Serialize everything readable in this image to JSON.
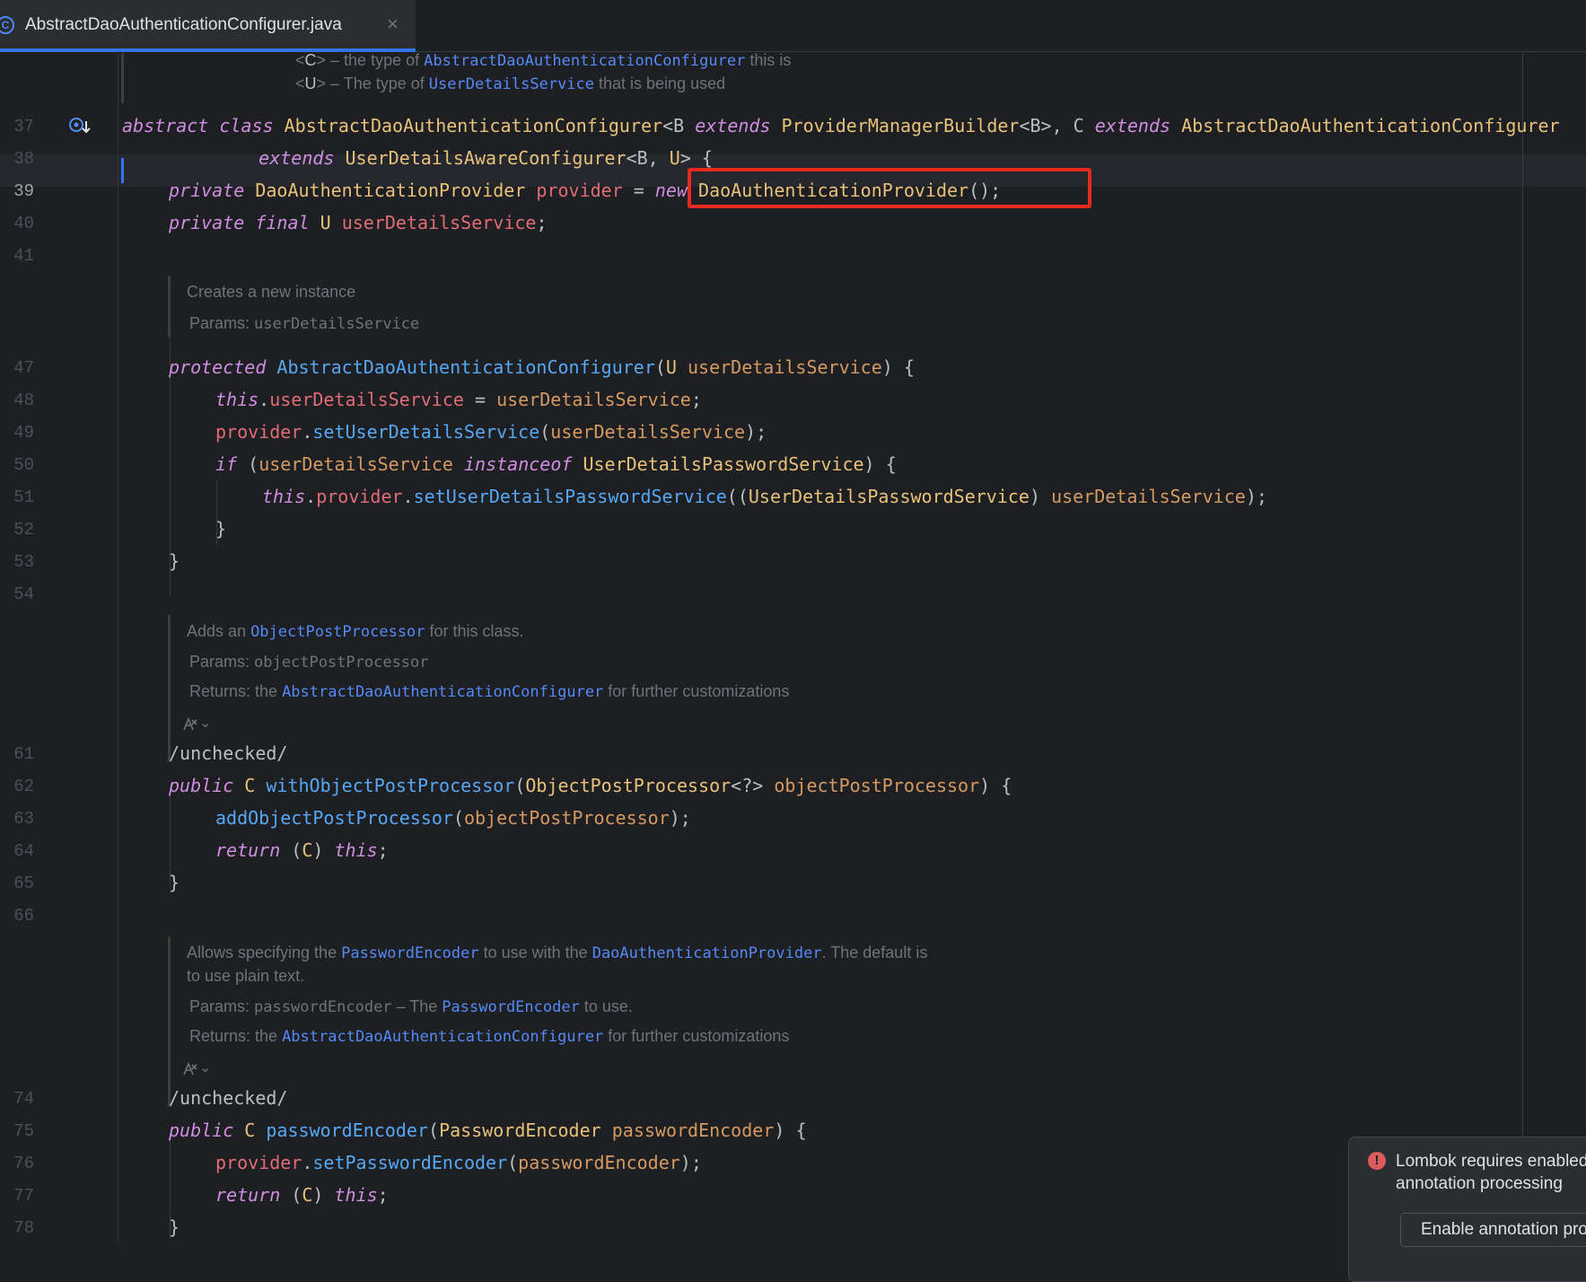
{
  "tab": {
    "icon": "C",
    "title": "AbstractDaoAuthenticationConfigurer.java",
    "close": "×"
  },
  "top_doc": {
    "line1_tag": "C",
    "line1_pre": " – the type of ",
    "line1_link": "AbstractDaoAuthenticationConfigurer",
    "line1_post": " this is",
    "line2_tag": "U",
    "line2_pre": " – The type of ",
    "line2_link": "UserDetailsService",
    "line2_post": " that is being used"
  },
  "line_numbers": {
    "l37": "37",
    "l38": "38",
    "l39": "39",
    "l40": "40",
    "l41": "41",
    "l47": "47",
    "l48": "48",
    "l49": "49",
    "l50": "50",
    "l51": "51",
    "l52": "52",
    "l53": "53",
    "l54": "54",
    "l61": "61",
    "l62": "62",
    "l63": "63",
    "l64": "64",
    "l65": "65",
    "l66": "66",
    "l74": "74",
    "l75": "75",
    "l76": "76",
    "l77": "77",
    "l78": "78"
  },
  "gutter_icon": "implemented-icon",
  "doc1": {
    "text": "Creates a new instance",
    "params_label": "Params:",
    "params_value": "userDetailsService"
  },
  "doc2": {
    "text_pre": "Adds an ",
    "text_link": "ObjectPostProcessor",
    "text_post": " for this class.",
    "params_label": "Params:",
    "params_value": "objectPostProcessor",
    "returns_label": "Returns:",
    "returns_pre": " the ",
    "returns_link": "AbstractDaoAuthenticationConfigurer",
    "returns_post": " for further customizations"
  },
  "doc3": {
    "text_pre": "Allows specifying the ",
    "text_link1": "PasswordEncoder",
    "text_mid": " to use with the ",
    "text_link2": "DaoAuthenticationProvider",
    "text_post": ". The default is",
    "text_line2": "to use plain text.",
    "params_label": "Params:",
    "params_value": "passwordEncoder",
    "params_dash": " – The ",
    "params_link": "PasswordEncoder",
    "params_post": " to use.",
    "returns_label": "Returns:",
    "returns_pre": " the ",
    "returns_link": "AbstractDaoAuthenticationConfigurer",
    "returns_post": " for further customizations"
  },
  "lens_icon": "ai-lens-icon",
  "lens_chevron": "⌄",
  "code": {
    "l37": [
      {
        "t": "abstract",
        "c": "kw"
      },
      {
        "t": " "
      },
      {
        "t": "class",
        "c": "kw"
      },
      {
        "t": " "
      },
      {
        "t": "AbstractDaoAuthenticationConfigurer",
        "c": "ty"
      },
      {
        "t": "<B "
      },
      {
        "t": "extends",
        "c": "kw"
      },
      {
        "t": " "
      },
      {
        "t": "ProviderManagerBuilder",
        "c": "ty"
      },
      {
        "t": "<B>, C "
      },
      {
        "t": "extends",
        "c": "kw"
      },
      {
        "t": " "
      },
      {
        "t": "AbstractDaoAuthenticationConfigurer",
        "c": "ty"
      }
    ],
    "l38": [
      {
        "t": "    "
      },
      {
        "t": "extends",
        "c": "kw"
      },
      {
        "t": " "
      },
      {
        "t": "UserDetailsAwareConfigurer",
        "c": "ty"
      },
      {
        "t": "<B, "
      },
      {
        "t": "U",
        "c": "ty"
      },
      {
        "t": "> {"
      }
    ],
    "l39": [
      {
        "t": "private",
        "c": "kw"
      },
      {
        "t": " "
      },
      {
        "t": "DaoAuthenticationProvider",
        "c": "ty"
      },
      {
        "t": " "
      },
      {
        "t": "provider",
        "c": "fld"
      },
      {
        "t": " = "
      },
      {
        "t": "new",
        "c": "kw"
      },
      {
        "t": " "
      },
      {
        "t": "DaoAuthenticationProvider",
        "c": "ty"
      },
      {
        "t": "();"
      }
    ],
    "l40": [
      {
        "t": "private",
        "c": "kw"
      },
      {
        "t": " "
      },
      {
        "t": "final",
        "c": "kw"
      },
      {
        "t": " "
      },
      {
        "t": "U",
        "c": "ty"
      },
      {
        "t": " "
      },
      {
        "t": "userDetailsService",
        "c": "fld"
      },
      {
        "t": ";"
      }
    ],
    "l47": [
      {
        "t": "protected",
        "c": "kw"
      },
      {
        "t": " "
      },
      {
        "t": "AbstractDaoAuthenticationConfigurer",
        "c": "fn"
      },
      {
        "t": "("
      },
      {
        "t": "U",
        "c": "ty"
      },
      {
        "t": " "
      },
      {
        "t": "userDetailsService",
        "c": "par"
      },
      {
        "t": ") {"
      }
    ],
    "l48": [
      {
        "t": "this",
        "c": "kw"
      },
      {
        "t": "."
      },
      {
        "t": "userDetailsService",
        "c": "fld"
      },
      {
        "t": " = "
      },
      {
        "t": "userDetailsService",
        "c": "par"
      },
      {
        "t": ";"
      }
    ],
    "l49": [
      {
        "t": "provider",
        "c": "fld"
      },
      {
        "t": "."
      },
      {
        "t": "setUserDetailsService",
        "c": "fn"
      },
      {
        "t": "("
      },
      {
        "t": "userDetailsService",
        "c": "par"
      },
      {
        "t": ");"
      }
    ],
    "l50": [
      {
        "t": "if",
        "c": "kw"
      },
      {
        "t": " ("
      },
      {
        "t": "userDetailsService",
        "c": "par"
      },
      {
        "t": " "
      },
      {
        "t": "instanceof",
        "c": "kw"
      },
      {
        "t": " "
      },
      {
        "t": "UserDetailsPasswordService",
        "c": "ty"
      },
      {
        "t": ") {"
      }
    ],
    "l51": [
      {
        "t": "this",
        "c": "kw"
      },
      {
        "t": "."
      },
      {
        "t": "provider",
        "c": "fld"
      },
      {
        "t": "."
      },
      {
        "t": "setUserDetailsPasswordService",
        "c": "fn"
      },
      {
        "t": "(("
      },
      {
        "t": "UserDetailsPasswordService",
        "c": "ty"
      },
      {
        "t": ") "
      },
      {
        "t": "userDetailsService",
        "c": "par"
      },
      {
        "t": ");"
      }
    ],
    "l52": [
      {
        "t": "}"
      }
    ],
    "l53": [
      {
        "t": "}"
      }
    ],
    "l61": [
      {
        "t": "/unchecked/",
        "c": "pl"
      }
    ],
    "l62": [
      {
        "t": "public",
        "c": "kw"
      },
      {
        "t": " "
      },
      {
        "t": "C",
        "c": "ty"
      },
      {
        "t": " "
      },
      {
        "t": "withObjectPostProcessor",
        "c": "fn"
      },
      {
        "t": "("
      },
      {
        "t": "ObjectPostProcessor",
        "c": "ty"
      },
      {
        "t": "<?> "
      },
      {
        "t": "objectPostProcessor",
        "c": "par"
      },
      {
        "t": ") {"
      }
    ],
    "l63": [
      {
        "t": "addObjectPostProcessor",
        "c": "fn"
      },
      {
        "t": "("
      },
      {
        "t": "objectPostProcessor",
        "c": "par"
      },
      {
        "t": ");"
      }
    ],
    "l64": [
      {
        "t": "return",
        "c": "kw"
      },
      {
        "t": " ("
      },
      {
        "t": "C",
        "c": "ty"
      },
      {
        "t": ") "
      },
      {
        "t": "this",
        "c": "kw"
      },
      {
        "t": ";"
      }
    ],
    "l65": [
      {
        "t": "}"
      }
    ],
    "l74": [
      {
        "t": "/unchecked/",
        "c": "pl"
      }
    ],
    "l75": [
      {
        "t": "public",
        "c": "kw"
      },
      {
        "t": " "
      },
      {
        "t": "C",
        "c": "ty"
      },
      {
        "t": " "
      },
      {
        "t": "passwordEncoder",
        "c": "fn"
      },
      {
        "t": "("
      },
      {
        "t": "PasswordEncoder",
        "c": "ty"
      },
      {
        "t": " "
      },
      {
        "t": "passwordEncoder",
        "c": "par"
      },
      {
        "t": ") {"
      }
    ],
    "l76": [
      {
        "t": "provider",
        "c": "fld"
      },
      {
        "t": "."
      },
      {
        "t": "setPasswordEncoder",
        "c": "fn"
      },
      {
        "t": "("
      },
      {
        "t": "passwordEncoder",
        "c": "par"
      },
      {
        "t": ");"
      }
    ],
    "l77": [
      {
        "t": "return",
        "c": "kw"
      },
      {
        "t": " ("
      },
      {
        "t": "C",
        "c": "ty"
      },
      {
        "t": ") "
      },
      {
        "t": "this",
        "c": "kw"
      },
      {
        "t": ";"
      }
    ],
    "l78": [
      {
        "t": "}"
      }
    ]
  },
  "notification": {
    "icon": "!",
    "message": "Lombok requires enabled annotation processing",
    "button": "Enable annotation processing"
  },
  "colors": {
    "highlight_box": "#e8291f",
    "accent": "#3574f0"
  }
}
